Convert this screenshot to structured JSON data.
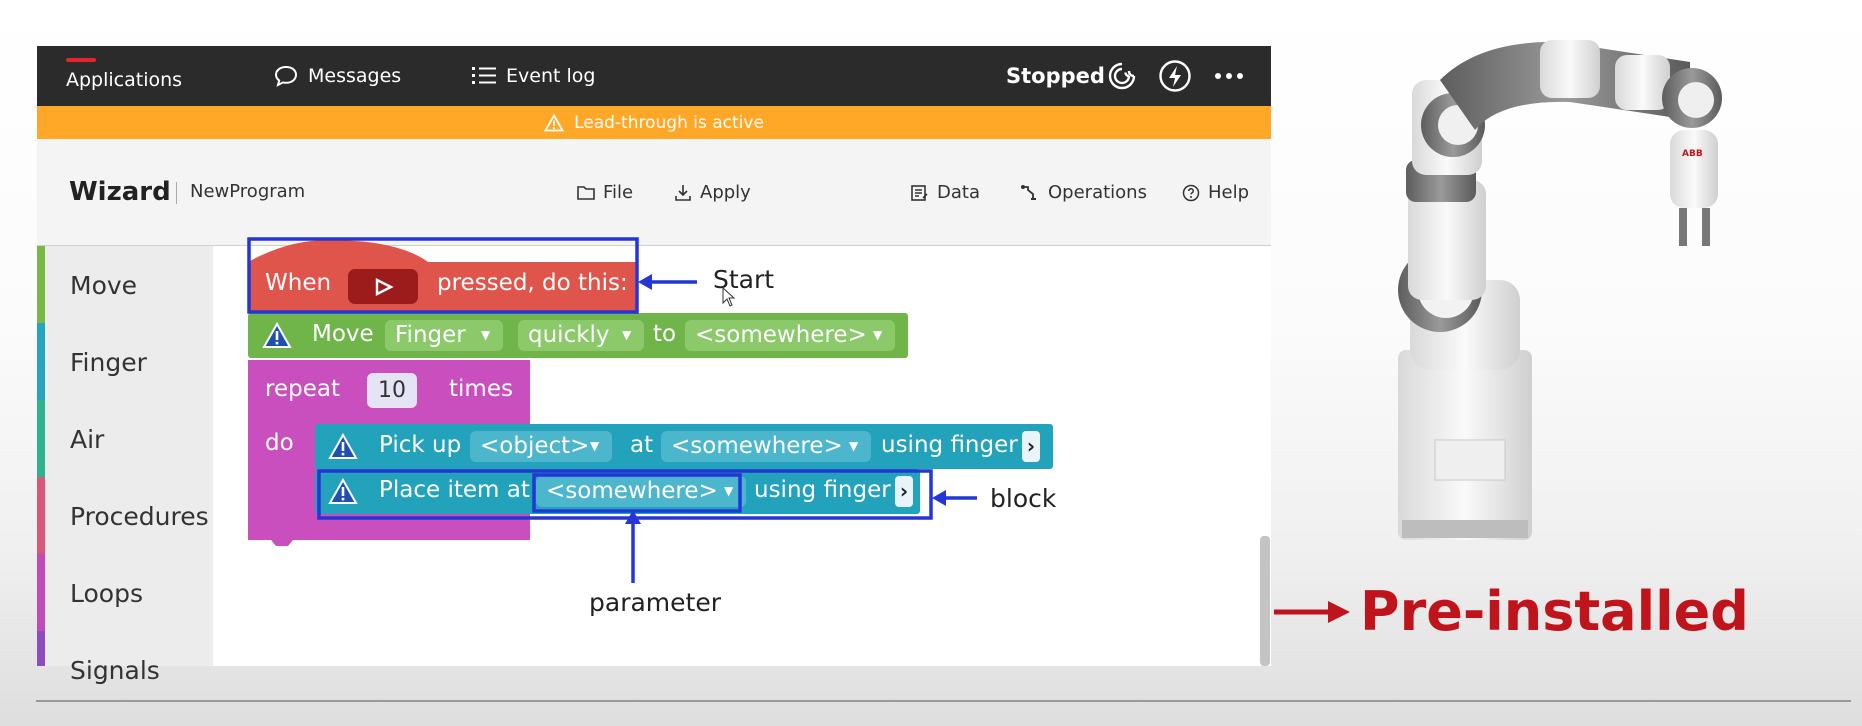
{
  "topbar": {
    "nav": [
      "Applications",
      "Messages",
      "Event log"
    ],
    "status": "Stopped",
    "icons": [
      "spiral-icon",
      "lightning-icon",
      "more-icon"
    ]
  },
  "banner": {
    "text": "Lead-through is active"
  },
  "toolbar": {
    "title": "Wizard",
    "program": "NewProgram",
    "file": "File",
    "apply": "Apply",
    "data": "Data",
    "operations": "Operations",
    "help": "Help"
  },
  "categories": [
    {
      "label": "Move",
      "color": "#7ab648"
    },
    {
      "label": "Finger",
      "color": "#26a5be"
    },
    {
      "label": "Air",
      "color": "#2fb28e"
    },
    {
      "label": "Procedures",
      "color": "#d9577a"
    },
    {
      "label": "Loops",
      "color": "#c14cb8"
    },
    {
      "label": "Signals",
      "color": "#8e4cc1"
    }
  ],
  "blocks": {
    "start": {
      "prefix": "When",
      "suffix": "pressed, do this:"
    },
    "move": {
      "label": "Move",
      "part": "Finger",
      "speed": "quickly",
      "to": "to",
      "target": "<somewhere>"
    },
    "repeat": {
      "label": "repeat",
      "count": "10",
      "times": "times",
      "do": "do"
    },
    "pick": {
      "label": "Pick up",
      "object": "<object>",
      "at": "at",
      "target": "<somewhere>",
      "using": "using finger"
    },
    "place": {
      "label": "Place item at",
      "target": "<somewhere>",
      "using": "using finger"
    }
  },
  "annotations": {
    "start": "Start",
    "block": "block",
    "parameter": "parameter",
    "preinstalled": "Pre-installed"
  },
  "colors": {
    "topbar": "#2b2b2b",
    "banner": "#ffa726",
    "event_block": "#e0554b",
    "move_block": "#6fb54a",
    "loop_block": "#c94fbf",
    "finger_block": "#23a3bb",
    "annotation": "#2436d6",
    "preinstalled": "#c0141d"
  }
}
